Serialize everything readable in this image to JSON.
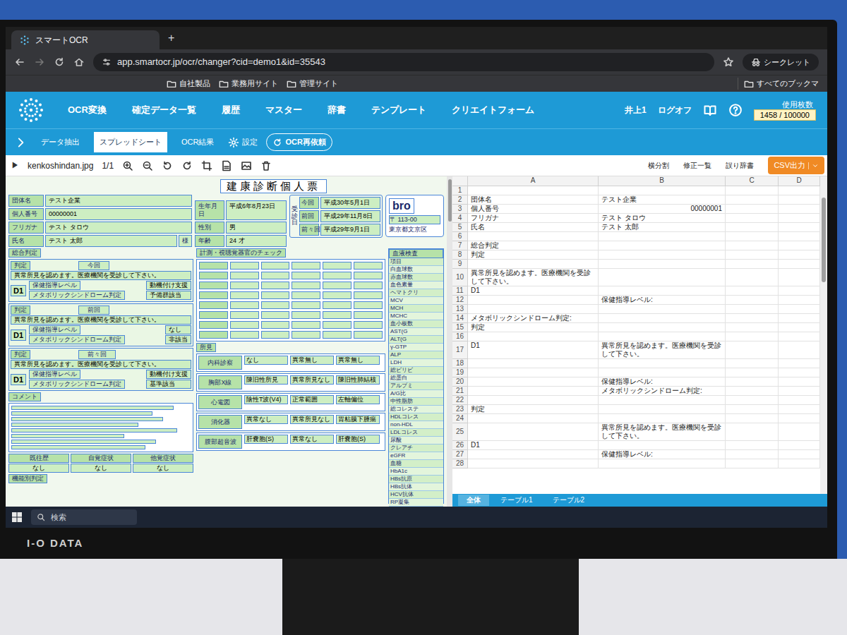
{
  "browser": {
    "tab_title": "スマートOCR",
    "new_tab": "+",
    "url": "app.smartocr.jp/ocr/changer?cid=demo1&id=35543",
    "bookmarks": [
      "自社製品",
      "業務用サイト",
      "管理サイト"
    ],
    "profile": "シークレット",
    "all_bookmarks": "すべてのブックマ"
  },
  "app": {
    "nav": [
      {
        "label": "OCR変換",
        "selected": false
      },
      {
        "label": "確定データ一覧",
        "selected": false
      },
      {
        "label": "履歴",
        "selected": false
      },
      {
        "label": "マスター",
        "selected": false
      },
      {
        "label": "辞書",
        "selected": false
      },
      {
        "label": "テンプレート",
        "selected": false
      },
      {
        "label": "クリエイトフォーム",
        "selected": false
      }
    ],
    "user": "井上1",
    "logoff": "ログオフ",
    "usage_label": "使用枚数",
    "usage": "1458 / 100000"
  },
  "subtabs": [
    {
      "label": "データ抽出",
      "selected": false
    },
    {
      "label": "スプレッドシート",
      "selected": true
    },
    {
      "label": "OCR結果",
      "selected": false
    }
  ],
  "settings": "設定",
  "reocr": "OCR再依頼",
  "doc_toolbar": {
    "play": "▶",
    "filename": "kenkoshindan.jpg",
    "page": "1/1"
  },
  "sheet_toolbar": [
    "横分割",
    "修正一覧",
    "誤り辞書"
  ],
  "csv": "CSV出力",
  "form": {
    "title": "建康診断個人票",
    "info": [
      {
        "label": "団体名",
        "value": "テスト企業"
      },
      {
        "label": "個人番号",
        "value": "00000001"
      },
      {
        "label": "フリガナ",
        "value": "テスト タロウ"
      },
      {
        "label": "氏名",
        "value": "テスト 太郎"
      }
    ],
    "sama": "様",
    "personal": [
      {
        "label": "生年月日",
        "value": "平成6年8月23日"
      },
      {
        "label": "性別",
        "value": "男"
      },
      {
        "label": "年齢",
        "value": "24 才"
      }
    ],
    "visit_label": "受診日",
    "visits": [
      {
        "label": "今回",
        "value": "平成30年5月1日"
      },
      {
        "label": "前回",
        "value": "平成29年11月8日"
      },
      {
        "label": "前々回",
        "value": "平成29年9月1日"
      }
    ],
    "logo": "bro",
    "postal": "〒 113-00",
    "address": "東京都文京区",
    "overall_header": "総合判定",
    "blocks": [
      {
        "label": "判定",
        "period": "今回",
        "text": "異常所見を認めます。医療機関を受診して下さい。",
        "grade": "D1",
        "level_label": "保健指導レベル",
        "metabo_label": "メタボリックシンドローム判定",
        "level": "動機付け支援",
        "metabo": "予備群該当"
      },
      {
        "label": "判定",
        "period": "前回",
        "text": "異常所見を認めます。医療機関を受診して下さい。",
        "grade": "D1",
        "level_label": "保健指導レベル",
        "metabo_label": "メタボリックシンドローム判定",
        "level": "なし",
        "metabo": "非該当"
      },
      {
        "label": "判定",
        "period": "前々回",
        "text": "異常所見を認めます。医療機関を受診して下さい。",
        "grade": "D1",
        "level_label": "保健指導レベル",
        "metabo_label": "メタボリックシンドローム判定",
        "level": "動機付け支援",
        "metabo": "基準該当"
      }
    ],
    "comment": "コメント",
    "history": [
      {
        "label": "既往歴",
        "value": "なし"
      },
      {
        "label": "自覚症状",
        "value": "なし"
      },
      {
        "label": "他覚症状",
        "value": "なし"
      }
    ],
    "function_label": "機能別判定",
    "checks_header": "計測・視聴覚器官のチェック",
    "findings_header": "所見",
    "findings": [
      {
        "label": "内科診察",
        "values": [
          "なし",
          "異常無し",
          "異常無し"
        ]
      },
      {
        "label": "胸部X線",
        "values": [
          "陳旧性所見",
          "異常所見なし",
          "陳旧性肺結核"
        ]
      },
      {
        "label": "心電図",
        "values": [
          "陰性T波(V4)",
          "正常範囲",
          "左軸偏位"
        ]
      },
      {
        "label": "消化器",
        "values": [
          "異常なし",
          "異常所見なし",
          "胃粘膜下腫瘍"
        ]
      },
      {
        "label": "腹部超音波",
        "values": [
          "肝嚢胞(S)",
          "異常なし",
          "肝嚢胞(S)"
        ]
      }
    ],
    "blood_header": "血液検査",
    "blood": [
      "項目",
      "白血球数",
      "赤血球数",
      "血色素量",
      "ヘマトクリ",
      "MCV",
      "MCH",
      "MCHC",
      "血小板数",
      "AST(G",
      "ALT(G",
      "γ-GTP",
      "ALP",
      "LDH",
      "総ビリビ",
      "総蛋白",
      "アルブミ",
      "A/G比",
      "中性脂肪",
      "総コレステ",
      "HDLコレス",
      "non-HDL",
      "LDLコレス",
      "尿酸",
      "クレアチ",
      "eGFR",
      "血糖",
      "HbA1c",
      "HBs抗原",
      "HBs抗体",
      "HCV抗体",
      "RP凝集"
    ]
  },
  "sheet": {
    "columns": [
      "A",
      "B",
      "C",
      "D"
    ],
    "rows": [
      {
        "n": "1",
        "a": "",
        "b": ""
      },
      {
        "n": "2",
        "a": "団体名",
        "b": "テスト企業"
      },
      {
        "n": "3",
        "a": "個人番号",
        "b": "00000001"
      },
      {
        "n": "4",
        "a": "フリガナ",
        "b": "テスト タロウ"
      },
      {
        "n": "5",
        "a": "氏名",
        "b": "テスト 太郎"
      },
      {
        "n": "6",
        "a": "",
        "b": ""
      },
      {
        "n": "7",
        "a": "総合判定",
        "b": ""
      },
      {
        "n": "8",
        "a": "判定",
        "b": ""
      },
      {
        "n": "9",
        "a": "",
        "b": ""
      },
      {
        "n": "10",
        "a": "異常所見を認めます。医療機関を受診して下さい。",
        "b": ""
      },
      {
        "n": "11",
        "a": "D1",
        "b": ""
      },
      {
        "n": "12",
        "a": "",
        "b": "保健指導レベル:"
      },
      {
        "n": "13",
        "a": "",
        "b": ""
      },
      {
        "n": "14",
        "a": "メタボリックシンドローム判定:",
        "b": ""
      },
      {
        "n": "15",
        "a": "判定",
        "b": ""
      },
      {
        "n": "16",
        "a": "",
        "b": ""
      },
      {
        "n": "17",
        "a": "D1",
        "b": "異常所見を認めます。医療機関を受診して下さい。"
      },
      {
        "n": "18",
        "a": "",
        "b": ""
      },
      {
        "n": "19",
        "a": "",
        "b": ""
      },
      {
        "n": "20",
        "a": "",
        "b": "保健指導レベル:"
      },
      {
        "n": "21",
        "a": "",
        "b": "メタボリックシンドローム判定:"
      },
      {
        "n": "22",
        "a": "",
        "b": ""
      },
      {
        "n": "23",
        "a": "判定",
        "b": ""
      },
      {
        "n": "24",
        "a": "",
        "b": ""
      },
      {
        "n": "25",
        "a": "",
        "b": "異常所見を認めます。医療機関を受診して下さい。"
      },
      {
        "n": "26",
        "a": "D1",
        "b": ""
      },
      {
        "n": "27",
        "a": "",
        "b": "保健指導レベル:"
      },
      {
        "n": "28",
        "a": "",
        "b": ""
      }
    ]
  },
  "sheet_tabs": [
    {
      "label": "全体",
      "selected": true
    },
    {
      "label": "テーブル1",
      "selected": false
    },
    {
      "label": "テーブル2",
      "selected": false
    }
  ],
  "taskbar": {
    "search": "検索"
  },
  "monitor": {
    "brand": "I-O DATA"
  }
}
